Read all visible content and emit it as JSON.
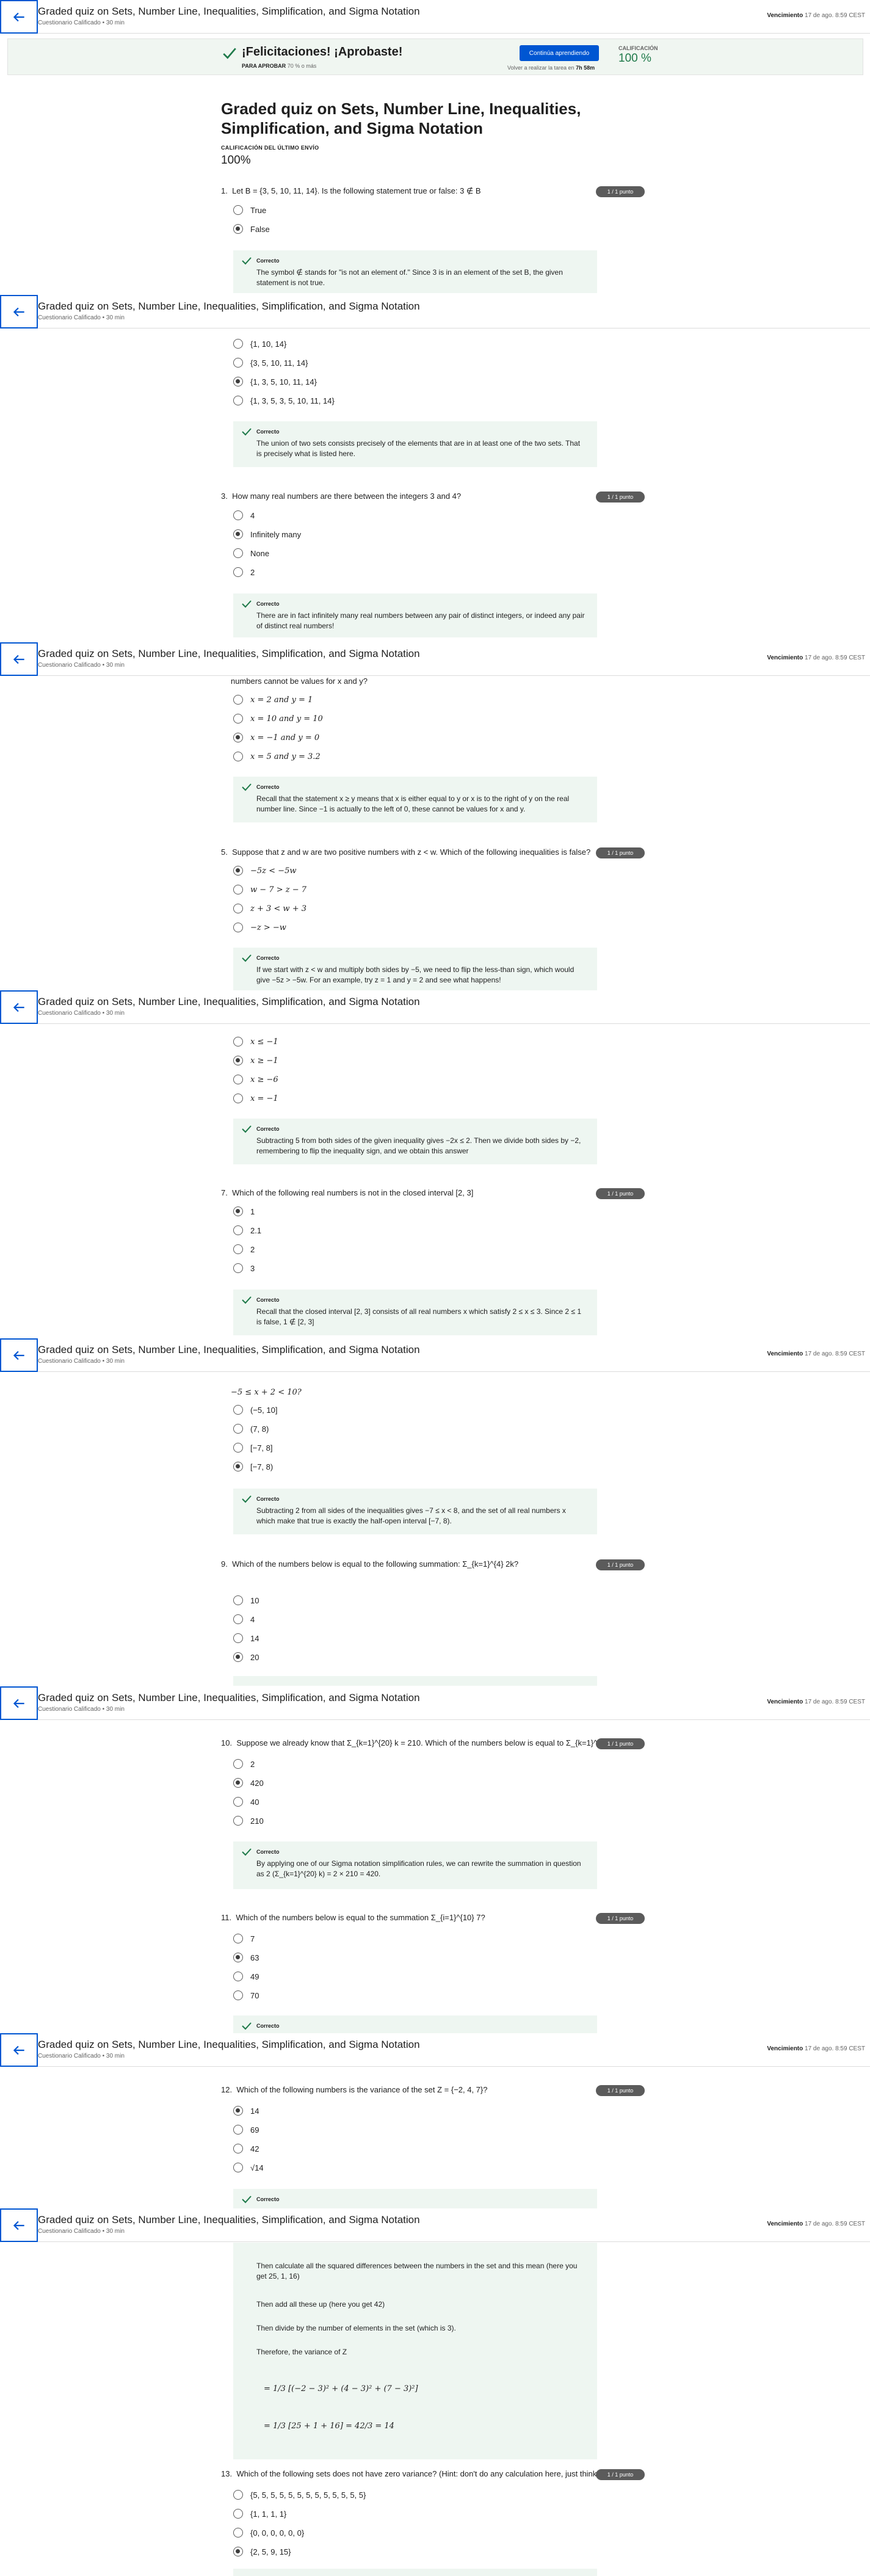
{
  "header": {
    "title": "Graded quiz on Sets, Number Line, Inequalities, Simplification, and Sigma Notation",
    "subtitle": "Cuestionario Calificado • 30 min",
    "due_label": "Vencimiento",
    "due_value": "17 de ago. 8:59 CEST"
  },
  "banner": {
    "heading": "¡Felicitaciones! ¡Aprobaste!",
    "pass_label": "PARA APROBAR",
    "pass_value": "70 % o más",
    "continue_button": "Continúa aprendiendo",
    "retry_label": "Volver a realizar la tarea en",
    "retry_value": "7h 58m",
    "grade_label": "CALIFICACIÓN",
    "grade_value": "100 %"
  },
  "page": {
    "title": "Graded quiz on Sets, Number Line, Inequalities, Simplification, and Sigma Notation",
    "last_grade_label": "CALIFICACIÓN DEL ÚLTIMO ENVÍO",
    "last_grade_value": "100%"
  },
  "points_badge": "1 / 1 punto",
  "correct_label": "Correcto",
  "questions": [
    {
      "number": "1.",
      "prompt": "Let B = {3, 5, 10, 11, 14}. Is the following statement true or false: 3 ∉ B",
      "options": [
        "True",
        "False"
      ],
      "selected": 1,
      "feedback": "The symbol ∉ stands for \"is not an element of.\" Since 3 is in an element of the set B, the given statement is not true."
    },
    {
      "number": "2.",
      "options": [
        "{1, 10, 14}",
        "{3, 5, 10, 11, 14}",
        "{1, 3, 5, 10, 11, 14}",
        "{1, 3, 5, 3, 5, 10, 11, 14}"
      ],
      "selected": 2,
      "feedback": "The union of two sets consists precisely of the elements that are in at least one of the two sets. That is precisely what is listed here."
    },
    {
      "number": "3.",
      "prompt": "How many real numbers are there between the integers 3 and 4?",
      "options": [
        "4",
        "Infinitely many",
        "None",
        "2"
      ],
      "selected": 1,
      "feedback": "There are in fact infinitely many real numbers between any pair of distinct integers, or indeed any pair of distinct real numbers!"
    },
    {
      "number": "4.",
      "prompt": "numbers cannot be values for x and y?",
      "options": [
        "x = 2 and y = 1",
        "x = 10 and y = 10",
        "x = −1 and y = 0",
        "x = 5 and y = 3.2"
      ],
      "selected": 2,
      "feedback": "Recall that the statement x ≥ y means that x is either equal to y or x is to the right of y on the real number line. Since −1 is actually to the left of 0, these cannot be values for x and y."
    },
    {
      "number": "5.",
      "prompt": "Suppose that z and w are two positive numbers with z < w. Which of the following inequalities is false?",
      "options": [
        "−5z < −5w",
        "w − 7 > z − 7",
        "z + 3 < w + 3",
        "−z > −w"
      ],
      "selected": 0,
      "feedback": "If we start with z < w and multiply both sides by −5, we need to flip the less-than sign, which would give −5z > −5w. For an example, try z = 1 and y = 2 and see what happens!"
    },
    {
      "number": "6.",
      "options": [
        "x ≤ −1",
        "x ≥ −1",
        "x ≥ −6",
        "x = −1"
      ],
      "selected": 1,
      "feedback": "Subtracting 5 from both sides of the given inequality gives −2x ≤ 2. Then we divide both sides by −2, remembering to flip the inequality sign, and we obtain this answer"
    },
    {
      "number": "7.",
      "prompt": "Which of the following real numbers is not in the closed interval [2, 3]",
      "options": [
        "1",
        "2.1",
        "2",
        "3"
      ],
      "selected": 0,
      "feedback": "Recall that the closed interval [2, 3] consists of all real numbers x which satisfy 2 ≤ x ≤ 3. Since 2 ≤ 1 is false, 1 ∉ [2, 3]"
    },
    {
      "number": "8.",
      "prompt": "−5 ≤ x + 2 < 10?",
      "options": [
        "(−5, 10]",
        "(7, 8)",
        "[−7, 8]",
        "[−7, 8)"
      ],
      "selected": 3,
      "feedback": "Subtracting 2 from all sides of the inequalities gives −7 ≤ x < 8, and the set of all real numbers x which make that true is exactly the half-open interval [−7, 8)."
    },
    {
      "number": "9.",
      "prompt": "Which of the numbers below is equal to the following summation: Σ_{k=1}^{4} 2k?",
      "options": [
        "10",
        "4",
        "14",
        "20"
      ],
      "selected": 3
    },
    {
      "number": "10.",
      "prompt": "Suppose we already know that Σ_{k=1}^{20} k = 210. Which of the numbers below is equal to Σ_{k=1}^{20} 2k?",
      "options": [
        "2",
        "420",
        "40",
        "210"
      ],
      "selected": 1,
      "feedback": "By applying one of our Sigma notation simplification rules, we can rewrite the summation in question as 2 (Σ_{k=1}^{20} k) = 2 × 210 = 420."
    },
    {
      "number": "11.",
      "prompt": "Which of the numbers below is equal to the summation Σ_{i=1}^{10} 7?",
      "options": [
        "7",
        "63",
        "49",
        "70"
      ],
      "selected": 1
    },
    {
      "number": "12.",
      "prompt": "Which of the following numbers is the variance of the set Z = {−2, 4, 7}?",
      "options": [
        "14",
        "69",
        "42",
        "√14"
      ],
      "selected": 0,
      "feedback_lines": [
        "Then calculate all the squared differences between the numbers in the set and this mean (here you get 25, 1, 16)",
        "Then add all these up (here you get 42)",
        "Then divide by the number of elements in the set (which is 3).",
        "Therefore, the variance of Z",
        "= 1/3 [(−2 − 3)² + (4 − 3)² + (7 − 3)²]",
        "= 1/3 [25 + 1 + 16] = 42/3 = 14"
      ]
    },
    {
      "number": "13.",
      "prompt": "Which of the following sets does not have zero variance? (Hint: don't do any calculation here, just think!)",
      "options": [
        "{5, 5, 5, 5, 5, 5, 5, 5, 5, 5, 5, 5, 5}",
        "{1, 1, 1, 1}",
        "{0, 0, 0, 0, 0, 0}",
        "{2, 5, 9, 15}"
      ],
      "selected": 3
    }
  ]
}
